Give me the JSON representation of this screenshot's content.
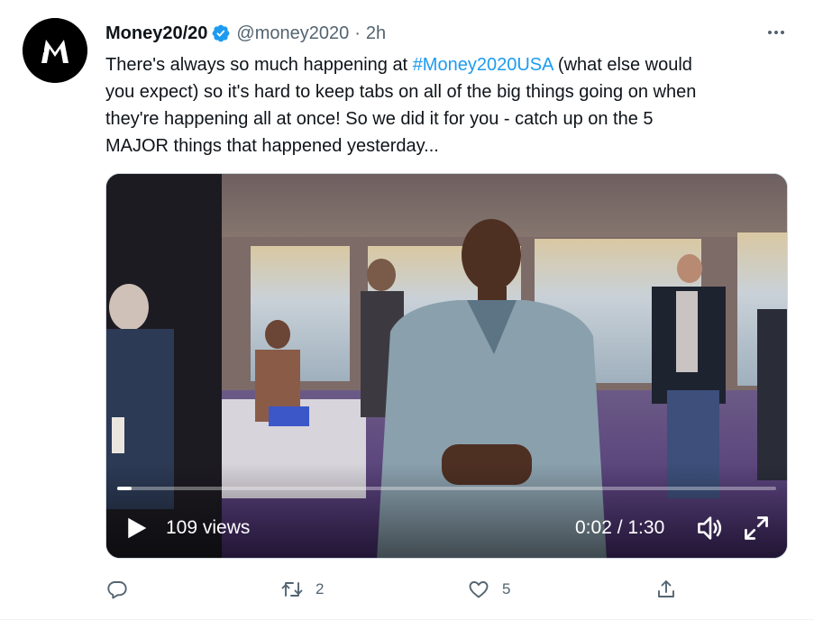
{
  "account": {
    "avatar_icon": "money2020-logo-icon",
    "display_name": "Money20/20",
    "verified_icon": "verified-badge-icon",
    "handle": "@money2020",
    "separator": "·",
    "timestamp": "2h"
  },
  "menu_icon": "more-options-icon",
  "tweet": {
    "lines": [
      [
        "There's always so much happening at ",
        "#Money2020USA",
        " (what else would"
      ],
      [
        "you expect) so it's hard to keep tabs on all of the big things going on when"
      ],
      [
        "they're happening all at once! So we did it for you - catch up on the 5"
      ],
      [
        "MAJOR things that happened yesterday..."
      ]
    ],
    "hashtag": "#Money2020USA"
  },
  "video": {
    "views": "109 views",
    "elapsed": "0:02",
    "duration": "1:30",
    "timecode": "0:02 / 1:30",
    "progress_fraction": 0.022,
    "play_icon": "play-icon",
    "volume_icon": "volume-icon",
    "fullscreen_icon": "fullscreen-icon"
  },
  "actions": {
    "reply": {
      "icon": "reply-icon",
      "count": ""
    },
    "retweet": {
      "icon": "retweet-icon",
      "count": "2"
    },
    "like": {
      "icon": "like-icon",
      "count": "5"
    },
    "share": {
      "icon": "share-icon",
      "count": ""
    }
  },
  "colors": {
    "accent": "#1d9bf0",
    "text": "#0f1419",
    "muted": "#536471"
  }
}
